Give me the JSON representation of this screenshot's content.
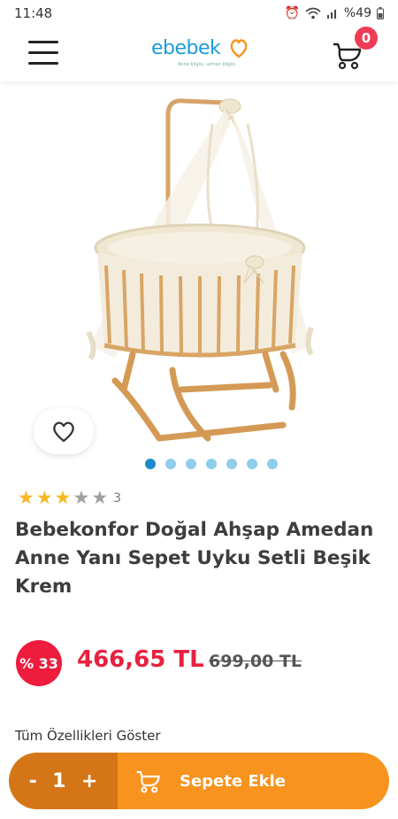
{
  "status_bar": {
    "time": "11:48",
    "battery": "%49",
    "icons": [
      "alarm-icon",
      "wifi-icon",
      "signal-icon",
      "battery-icon"
    ]
  },
  "header": {
    "logo_text": "ebebek",
    "logo_tagline": "Anne bilgisi, uzman bilgisi",
    "cart_count": "0",
    "brand_color": "#1e9bd7",
    "badge_color": "#f03b56"
  },
  "gallery": {
    "image_count": 7,
    "active_index": 0
  },
  "product": {
    "rating": 3,
    "rating_max": 5,
    "rating_count": "3",
    "title": "Bebekonfor Doğal Ahşap Amedan Anne Yanı Sepet Uyku Setli Beşik Krem",
    "discount": "% 33",
    "price": "466,65 TL",
    "old_price": "699,00 TL",
    "price_color": "#e8213f"
  },
  "links": {
    "all_features": "Tüm Özellikleri Göster"
  },
  "cart_bar": {
    "minus": "-",
    "quantity": "1",
    "plus": "+",
    "add_label": "Sepete Ekle",
    "qty_bg": "#d47618",
    "add_bg": "#f7931e"
  }
}
